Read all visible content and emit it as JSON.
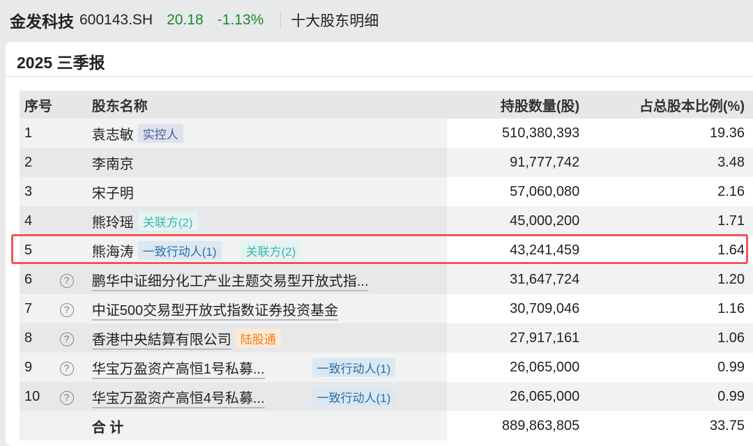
{
  "header": {
    "stock_name": "金发科技",
    "stock_code": "600143.SH",
    "price": "20.18",
    "change": "-1.13%",
    "page_title": "十大股东明细"
  },
  "report": {
    "title": "2025 三季报"
  },
  "table": {
    "columns": [
      "序号",
      "股东名称",
      "持股数量(股)",
      "占总股本比例(%)"
    ],
    "rows": [
      {
        "no": "1",
        "name": "袁志敏",
        "tags": [
          {
            "label": "实控人",
            "type": "ctrl"
          }
        ],
        "shares": "510,380,393",
        "pct": "19.36"
      },
      {
        "no": "2",
        "name": "李南京",
        "tags": [],
        "shares": "91,777,742",
        "pct": "3.48"
      },
      {
        "no": "3",
        "name": "宋子明",
        "tags": [],
        "shares": "57,060,080",
        "pct": "2.16"
      },
      {
        "no": "4",
        "name": "熊玲瑶",
        "tags": [
          {
            "label": "关联方(2)",
            "type": "rel"
          }
        ],
        "shares": "45,000,200",
        "pct": "1.71"
      },
      {
        "no": "5",
        "name": "熊海涛",
        "tags": [
          {
            "label": "一致行动人(1)",
            "type": "act"
          },
          {
            "label": "关联方(2)",
            "type": "rel"
          }
        ],
        "shares": "43,241,459",
        "pct": "1.64"
      },
      {
        "no": "6",
        "name": "鹏华中证细分化工产业主题交易型开放式指...",
        "help": true,
        "tags": [],
        "shares": "31,647,724",
        "pct": "1.20"
      },
      {
        "no": "7",
        "name": "中证500交易型开放式指数证券投资基金",
        "help": true,
        "tags": [],
        "shares": "30,709,046",
        "pct": "1.16"
      },
      {
        "no": "8",
        "name": "香港中央結算有限公司",
        "help": true,
        "tags": [
          {
            "label": "陆股通",
            "type": "hk"
          }
        ],
        "shares": "27,917,161",
        "pct": "1.06"
      },
      {
        "no": "9",
        "name": "华宝万盈资产高恒1号私募...",
        "help": true,
        "tags": [
          {
            "label": "一致行动人(1)",
            "type": "act",
            "wide": true
          }
        ],
        "shares": "26,065,000",
        "pct": "0.99"
      },
      {
        "no": "10",
        "name": "华宝万盈资产高恒4号私募...",
        "help": true,
        "tags": [
          {
            "label": "一致行动人(1)",
            "type": "act",
            "wide": true
          }
        ],
        "shares": "26,065,000",
        "pct": "0.99"
      }
    ],
    "total": {
      "label": "合 计",
      "shares": "889,863,805",
      "pct": "33.75"
    }
  }
}
